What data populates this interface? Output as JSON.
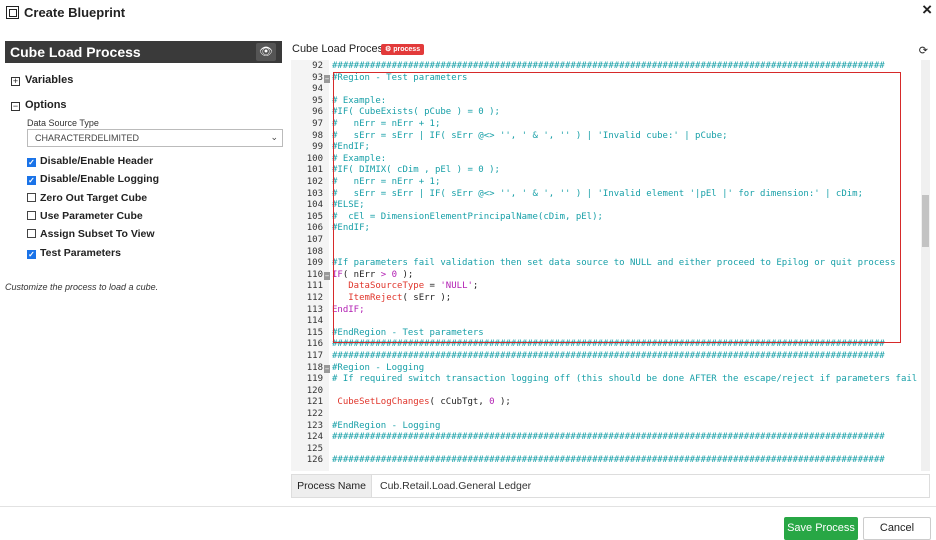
{
  "window": {
    "title": "Create Blueprint",
    "close_glyph": "×"
  },
  "left_panel": {
    "title": "Cube Load Process",
    "eye_glyph": "👁",
    "variables_label": "Variables",
    "options_label": "Options",
    "data_source_label": "Data Source Type",
    "data_source_value": "CHARACTERDELIMITED",
    "checkboxes": [
      {
        "label": "Disable/Enable Header",
        "checked": true
      },
      {
        "label": "Disable/Enable Logging",
        "checked": true
      },
      {
        "label": "Zero Out Target Cube",
        "checked": false
      },
      {
        "label": "Use Parameter Cube",
        "checked": false
      },
      {
        "label": "Assign Subset To View",
        "checked": false
      },
      {
        "label": "Test Parameters",
        "checked": true
      }
    ],
    "hint": "Customize the process to load a cube."
  },
  "editor_header": {
    "title": "Cube Load Process",
    "badge": "process"
  },
  "code": {
    "lines": [
      {
        "n": "92",
        "t": "######################################################################################################",
        "c": "com"
      },
      {
        "n": "93",
        "t": "#Region - Test parameters",
        "c": "com",
        "fold": true
      },
      {
        "n": "94",
        "t": "",
        "c": "com"
      },
      {
        "n": "95",
        "t": "# Example:",
        "c": "com"
      },
      {
        "n": "96",
        "t": "#IF( CubeExists( pCube ) = 0 );",
        "c": "com"
      },
      {
        "n": "97",
        "t": "#   nErr = nErr + 1;",
        "c": "com"
      },
      {
        "n": "98",
        "t": "#   sErr = sErr | IF( sErr @<> '', ' & ', '' ) | 'Invalid cube:' | pCube;",
        "c": "com"
      },
      {
        "n": "99",
        "t": "#EndIF;",
        "c": "com"
      },
      {
        "n": "100",
        "t": "# Example:",
        "c": "com"
      },
      {
        "n": "101",
        "t": "#IF( DIMIX( cDim , pEl ) = 0 );",
        "c": "com"
      },
      {
        "n": "102",
        "t": "#   nErr = nErr + 1;",
        "c": "com"
      },
      {
        "n": "103",
        "t": "#   sErr = sErr | IF( sErr @<> '', ' & ', '' ) | 'Invalid element '|pEl |' for dimension:' | cDim;",
        "c": "com"
      },
      {
        "n": "104",
        "t": "#ELSE;",
        "c": "com"
      },
      {
        "n": "105",
        "t": "#  cEl = DimensionElementPrincipalName(cDim, pEl);",
        "c": "com"
      },
      {
        "n": "106",
        "t": "#EndIF;",
        "c": "com"
      },
      {
        "n": "107",
        "t": "",
        "c": "com"
      },
      {
        "n": "108",
        "t": "",
        "c": "com"
      },
      {
        "n": "109",
        "t": "#If parameters fail validation then set data source to NULL and either proceed to Epilog or quit process",
        "c": "com"
      },
      {
        "n": "110",
        "t": "IF( nErr > 0 );",
        "c": "if110",
        "fold": true
      },
      {
        "n": "111",
        "t": "   DataSourceType = 'NULL';",
        "c": "ds111"
      },
      {
        "n": "112",
        "t": "   ItemReject( sErr );",
        "c": "ir112"
      },
      {
        "n": "113",
        "t": "EndIF;",
        "c": "kw"
      },
      {
        "n": "114",
        "t": "",
        "c": "com"
      },
      {
        "n": "115",
        "t": "#EndRegion - Test parameters",
        "c": "com"
      },
      {
        "n": "116",
        "t": "######################################################################################################",
        "c": "com"
      },
      {
        "n": "117",
        "t": "######################################################################################################",
        "c": "com"
      },
      {
        "n": "118",
        "t": "#Region - Logging",
        "c": "com",
        "fold": true
      },
      {
        "n": "119",
        "t": "# If required switch transaction logging off (this should be done AFTER the escape/reject if parameters fail",
        "c": "com"
      },
      {
        "n": "120",
        "t": "",
        "c": "com"
      },
      {
        "n": "121",
        "t": " CubeSetLogChanges( cCubTgt, 0 );",
        "c": "cs121"
      },
      {
        "n": "122",
        "t": "",
        "c": "com"
      },
      {
        "n": "123",
        "t": "#EndRegion - Logging",
        "c": "com"
      },
      {
        "n": "124",
        "t": "######################################################################################################",
        "c": "com"
      },
      {
        "n": "125",
        "t": "",
        "c": "com"
      },
      {
        "n": "126",
        "t": "######################################################################################################",
        "c": "com"
      }
    ]
  },
  "process_name": {
    "label": "Process Name",
    "value": "Cub.Retail.Load.General Ledger"
  },
  "footer": {
    "save_label": "Save Process",
    "cancel_label": "Cancel"
  },
  "colors": {
    "accent": "#1a73e8",
    "save": "#28a745",
    "badge": "#e23a3a",
    "comment": "#18a0a8",
    "keyword": "#b21fb3",
    "function": "#e0352b",
    "highlight_box": "#d62a2a"
  }
}
